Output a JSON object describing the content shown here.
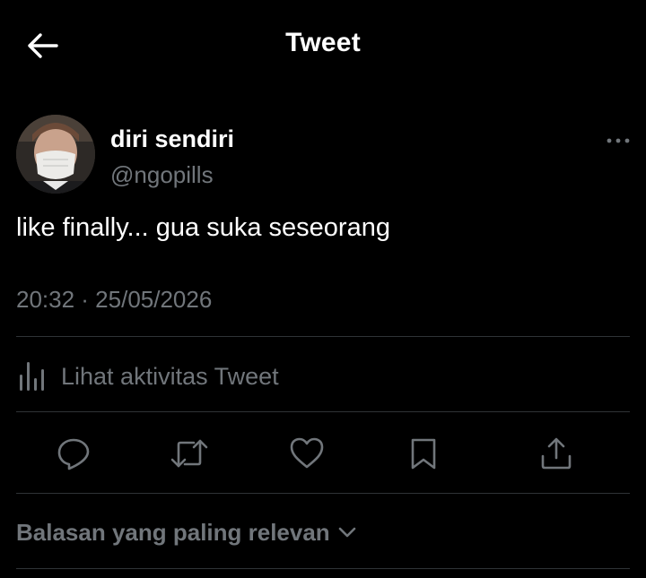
{
  "header": {
    "title": "Tweet",
    "back_icon": "arrow-left-icon"
  },
  "tweet": {
    "author": {
      "display_name": "diri sendiri",
      "username": "@ngopills",
      "avatar": "avatar-photo"
    },
    "more_icon": "more-horizontal-icon",
    "text": "like finally... gua suka seseorang",
    "timestamp": "20:32 · 25/05/2026"
  },
  "activity": {
    "icon": "bar-chart-icon",
    "label": "Lihat aktivitas Tweet"
  },
  "actions": [
    {
      "name": "reply",
      "icon": "reply-icon"
    },
    {
      "name": "retweet",
      "icon": "retweet-icon"
    },
    {
      "name": "like",
      "icon": "heart-icon"
    },
    {
      "name": "bookmark",
      "icon": "bookmark-icon"
    },
    {
      "name": "share",
      "icon": "share-icon"
    }
  ],
  "replies_sort": {
    "label": "Balasan yang paling relevan",
    "icon": "chevron-down-icon"
  },
  "colors": {
    "background": "#000000",
    "primary_text": "#ffffff",
    "secondary_text": "#71767b",
    "divider": "#2f3336"
  }
}
